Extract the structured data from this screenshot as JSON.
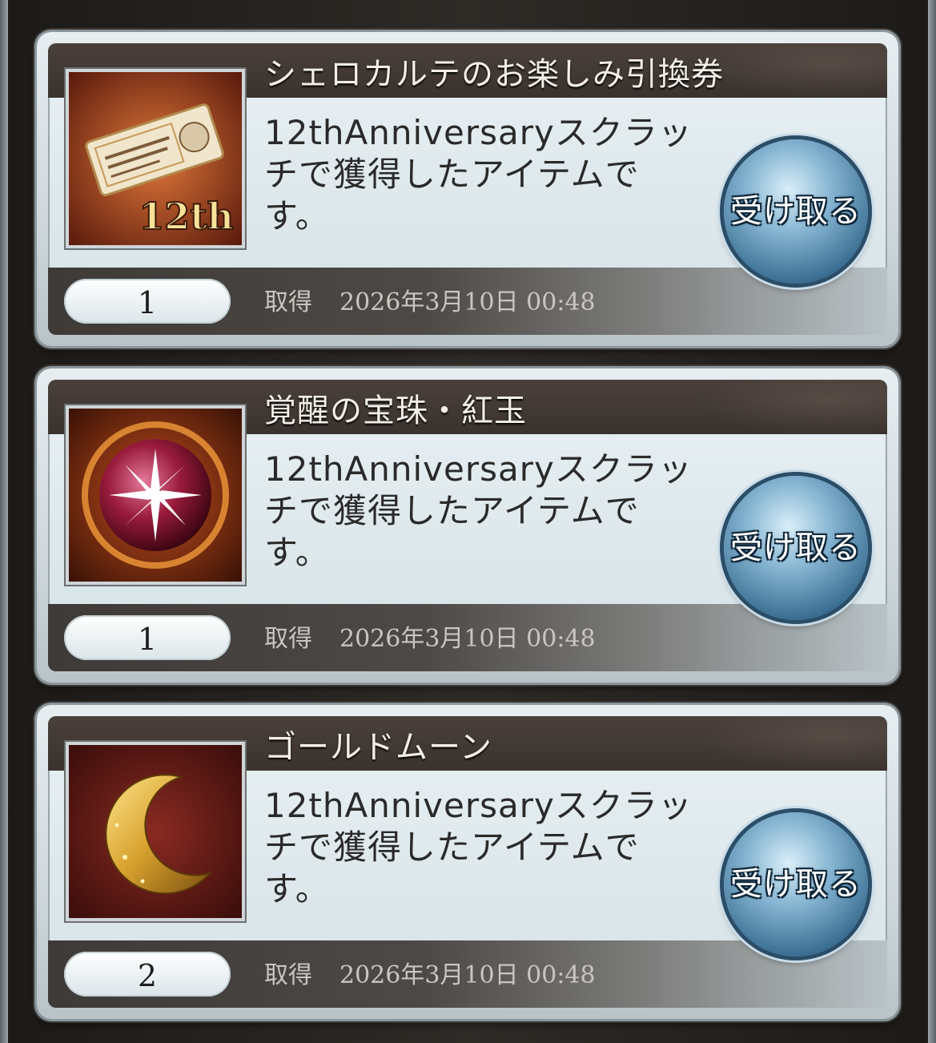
{
  "acquired_label": "取得",
  "items": [
    {
      "name": "シェロカルテのお楽しみ引換券",
      "description": "12thAnniversaryスクラッチで獲得したアイテムです。",
      "quantity": "1",
      "acquired_date": "2026年3月10日 00:48",
      "claim_label": "受け取る",
      "icon": "ticket-icon",
      "icon_text": "12th"
    },
    {
      "name": "覚醒の宝珠・紅玉",
      "description": "12thAnniversaryスクラッチで獲得したアイテムです。",
      "quantity": "1",
      "acquired_date": "2026年3月10日 00:48",
      "claim_label": "受け取る",
      "icon": "red-orb-icon"
    },
    {
      "name": "ゴールドムーン",
      "description": "12thAnniversaryスクラッチで獲得したアイテムです。",
      "quantity": "2",
      "acquired_date": "2026年3月10日 00:48",
      "claim_label": "受け取る",
      "icon": "gold-moon-icon"
    }
  ]
}
